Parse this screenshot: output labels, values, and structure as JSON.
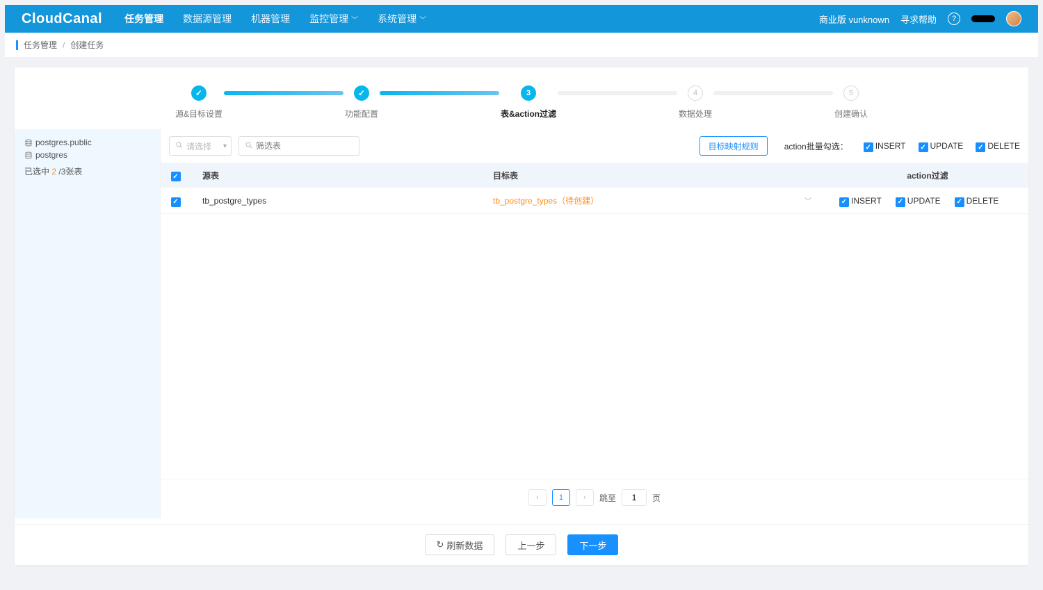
{
  "brand": "CloudCanal",
  "nav": {
    "items": [
      "任务管理",
      "数据源管理",
      "机器管理",
      "监控管理",
      "系统管理"
    ],
    "active_index": 0,
    "version": "商业版 vunknown",
    "help": "寻求帮助"
  },
  "breadcrumb": {
    "a": "任务管理",
    "b": "创建任务"
  },
  "steps": {
    "labels": [
      "源&目标设置",
      "功能配置",
      "表&action过滤",
      "数据处理",
      "创建确认"
    ],
    "current_index": 2,
    "pending_nums": [
      "4",
      "5"
    ],
    "current_num": "3"
  },
  "sidebar": {
    "db1": "postgres.public",
    "db2": "postgres",
    "selected_prefix": "已选中 ",
    "selected_count": "2",
    "selected_suffix": " /3张表"
  },
  "toolbar": {
    "select_placeholder": "请选择",
    "search_placeholder": "筛选表",
    "mapping_btn": "目标映射规则",
    "bulk_label": "action批量勾选：",
    "actions": {
      "insert": "INSERT",
      "update": "UPDATE",
      "delete": "DELETE"
    }
  },
  "table": {
    "headers": {
      "src": "源表",
      "tgt": "目标表",
      "act": "action过滤"
    },
    "rows": [
      {
        "src": "tb_postgre_types",
        "tgt": "tb_postgre_types（待创建）",
        "actions": {
          "insert": "INSERT",
          "update": "UPDATE",
          "delete": "DELETE"
        }
      }
    ]
  },
  "pager": {
    "current": "1",
    "jump_label": "跳至",
    "page_suffix": "页",
    "jump_value": "1"
  },
  "footer": {
    "refresh": "刷新数据",
    "prev": "上一步",
    "next": "下一步"
  }
}
